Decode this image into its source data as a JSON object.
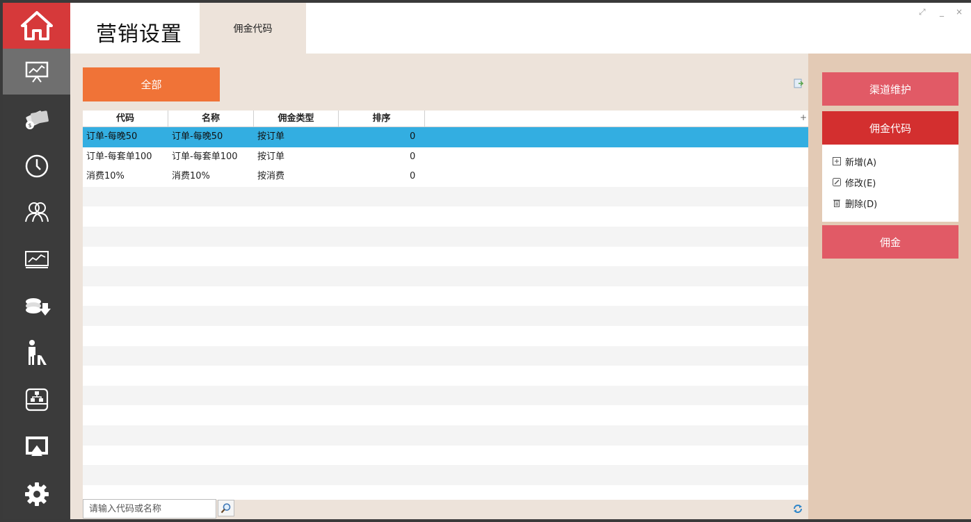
{
  "header": {
    "title": "营销设置",
    "tab_label": "佣金代码"
  },
  "nav": {
    "items": [
      "home-icon",
      "presentation-chart-icon",
      "money-icon",
      "clock-icon",
      "users-icon",
      "line-chart-icon",
      "coins-icon",
      "person-luggage-icon",
      "network-tray-icon",
      "airplay-icon",
      "gear-icon"
    ]
  },
  "main": {
    "all_button": "全部",
    "columns": [
      "代码",
      "名称",
      "佣金类型",
      "排序"
    ],
    "rows": [
      {
        "code": "订单-每晚50",
        "name": "订单-每晚50",
        "type": "按订单",
        "order": "0"
      },
      {
        "code": "订单-每套单100",
        "name": "订单-每套单100",
        "type": "按订单",
        "order": "0"
      },
      {
        "code": "消费10%",
        "name": "消费10%",
        "type": "按消费",
        "order": "0"
      }
    ],
    "search_placeholder": "请输入代码或名称"
  },
  "side": {
    "channel_button": "渠道维护",
    "commission_code_button": "佣金代码",
    "add_label": "新增(A)",
    "edit_label": "修改(E)",
    "delete_label": "删除(D)",
    "commission_button": "佣金"
  },
  "colors": {
    "accent_orange": "#f07337",
    "selected_row": "#33aee1",
    "side_pink": "#e15a66",
    "side_red": "#d32f2f",
    "nav_home": "#d6393a"
  }
}
